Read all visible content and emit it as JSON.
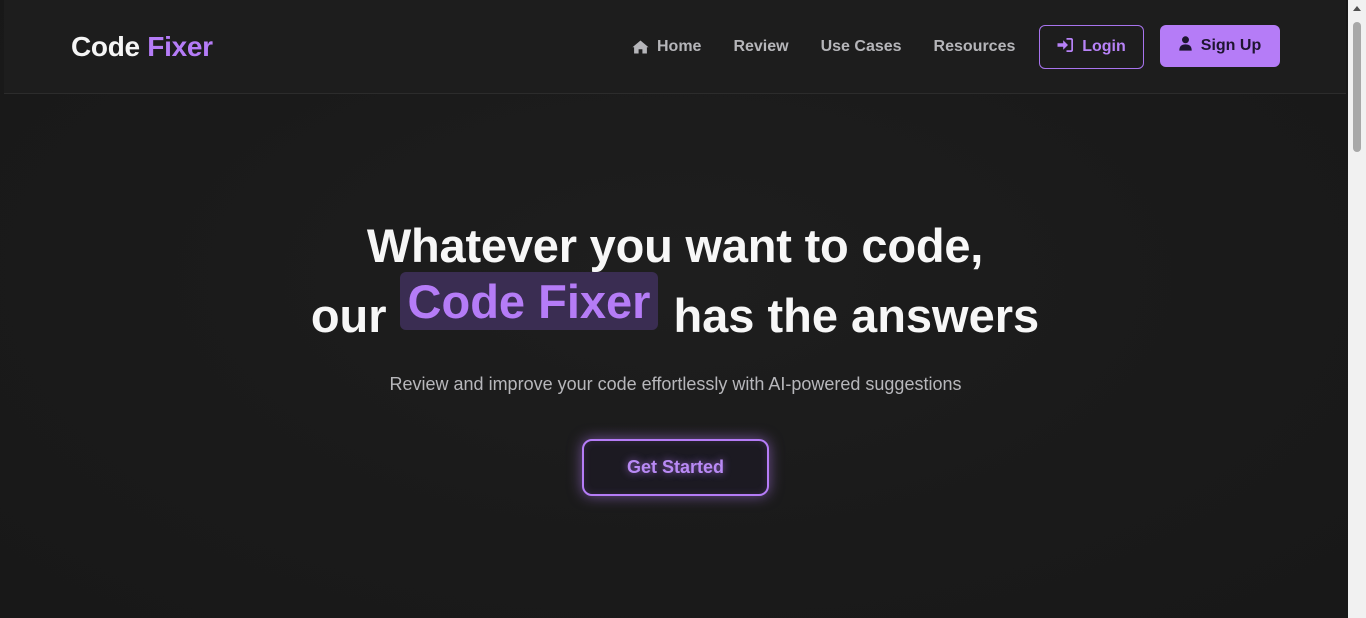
{
  "brand": {
    "part1": "Code",
    "part2": "Fixer"
  },
  "nav": {
    "items": [
      {
        "label": "Home",
        "icon": "home-icon"
      },
      {
        "label": "Review"
      },
      {
        "label": "Use Cases"
      },
      {
        "label": "Resources"
      }
    ],
    "login_label": "Login",
    "login_icon": "sign-in-icon",
    "signup_label": "Sign Up",
    "signup_icon": "user-icon"
  },
  "hero": {
    "line1": "Whatever you want to code,",
    "line2_before": "our",
    "line2_highlight": "Code Fixer",
    "line2_after": "has the answers",
    "subtitle": "Review and improve your code effortlessly with AI-powered suggestions",
    "cta_label": "Get Started"
  },
  "colors": {
    "accent": "#b57cf7",
    "background": "#1b1b1b",
    "highlight_bg": "#3a2d52"
  }
}
